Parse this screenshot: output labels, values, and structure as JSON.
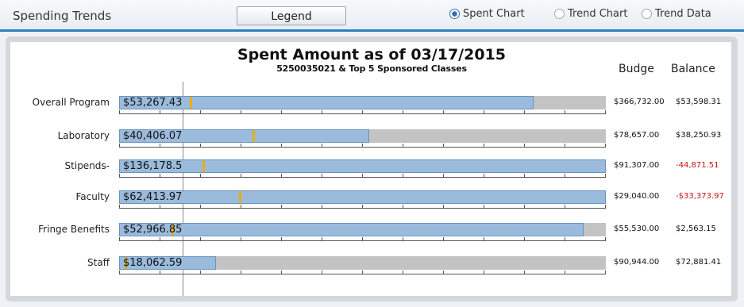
{
  "header": {
    "title": "Spending Trends",
    "legend_button": "Legend",
    "radios": [
      {
        "label": "Spent Chart",
        "checked": true
      },
      {
        "label": "Trend Chart",
        "checked": false
      },
      {
        "label": "Trend  Data",
        "checked": false
      }
    ]
  },
  "chart_data": {
    "type": "bar",
    "title": "Spent Amount as of  03/17/2015",
    "subtitle": "5250035021 & Top 5 Sponsored Classes",
    "columns": {
      "budget": "Budge",
      "balance": "Balance"
    },
    "categories": [
      "Overall Program",
      "Laboratory",
      "Stipends-",
      "Faculty",
      "Fringe Benefits",
      "Staff"
    ],
    "spent_labels": [
      "$53,267.43",
      "$40,406.07",
      "$136,178.5",
      "$62,413.97",
      "$52,966.85",
      "$18,062.59"
    ],
    "spent": [
      53267.43,
      40406.07,
      136178.5,
      62413.97,
      52966.85,
      18062.59
    ],
    "budget_labels": [
      "$366,732.00",
      "$78,657.00",
      "$91,307.00",
      "$29,040.00",
      "$55,530.00",
      "$90,944.00"
    ],
    "balance_labels": [
      "$53,598.31",
      "$38,250.93",
      "-44,871.51",
      "-$33,373.97",
      "$2,563.15",
      "$72,881.41"
    ],
    "balance_negative": [
      false,
      false,
      true,
      true,
      false,
      false
    ],
    "spent_fraction": [
      0.852,
      0.514,
      1.0,
      1.0,
      0.954,
      0.199
    ],
    "marker_fraction": [
      0.145,
      0.274,
      0.172,
      0.246,
      0.107,
      0.012
    ]
  }
}
